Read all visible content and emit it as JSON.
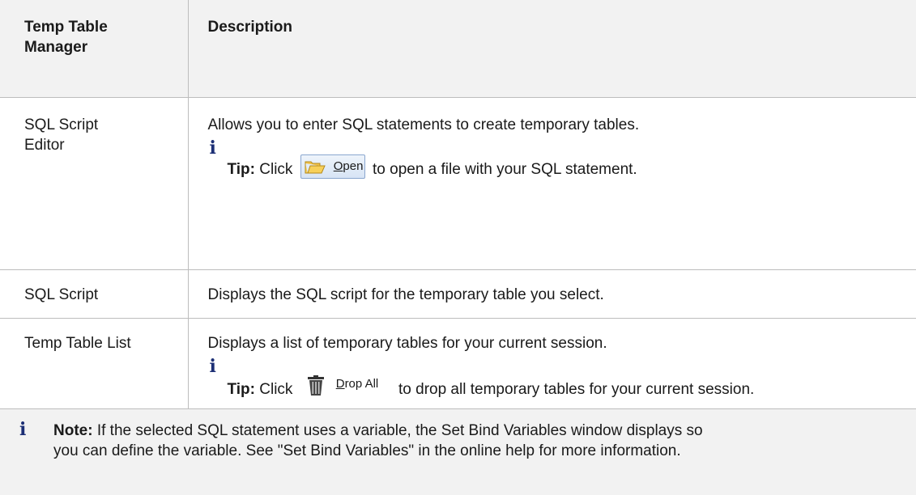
{
  "table": {
    "headers": [
      "Temp Table Manager",
      "Description"
    ],
    "header_col1_lines": [
      "Temp Table",
      "Manager"
    ],
    "rows": [
      {
        "name_lines": [
          "SQL Script",
          "Editor"
        ],
        "description": "Allows you to enter SQL statements to create temporary tables.",
        "tip": {
          "label": "Tip:",
          "before": "Click",
          "button_label": "Open",
          "button_mnemonic": "O",
          "button_rest": "pen",
          "after": "to open a file with your SQL statement."
        }
      },
      {
        "name": "SQL Script",
        "description": "Displays the SQL script for the temporary table you select."
      },
      {
        "name": "Temp Table List",
        "description": "Displays a list of temporary tables for your current session.",
        "tip": {
          "label": "Tip:",
          "before": "Click",
          "button_label": "Drop All",
          "button_mnemonic": "D",
          "button_rest": "rop All",
          "after": "to drop all temporary tables for your current session."
        }
      }
    ],
    "note": {
      "label": "Note:",
      "line1": "If the selected SQL statement uses a variable, the Set Bind Variables window displays so",
      "line2": "you can define the variable. See \"Set Bind Variables\" in the online help for more information."
    }
  },
  "icons": {
    "info": "info-icon",
    "folder": "folder-open-icon",
    "trash": "trash-icon"
  },
  "colors": {
    "header_bg": "#f2f2f2",
    "border": "#bdbdbd",
    "info_icon": "#1c2f75"
  }
}
